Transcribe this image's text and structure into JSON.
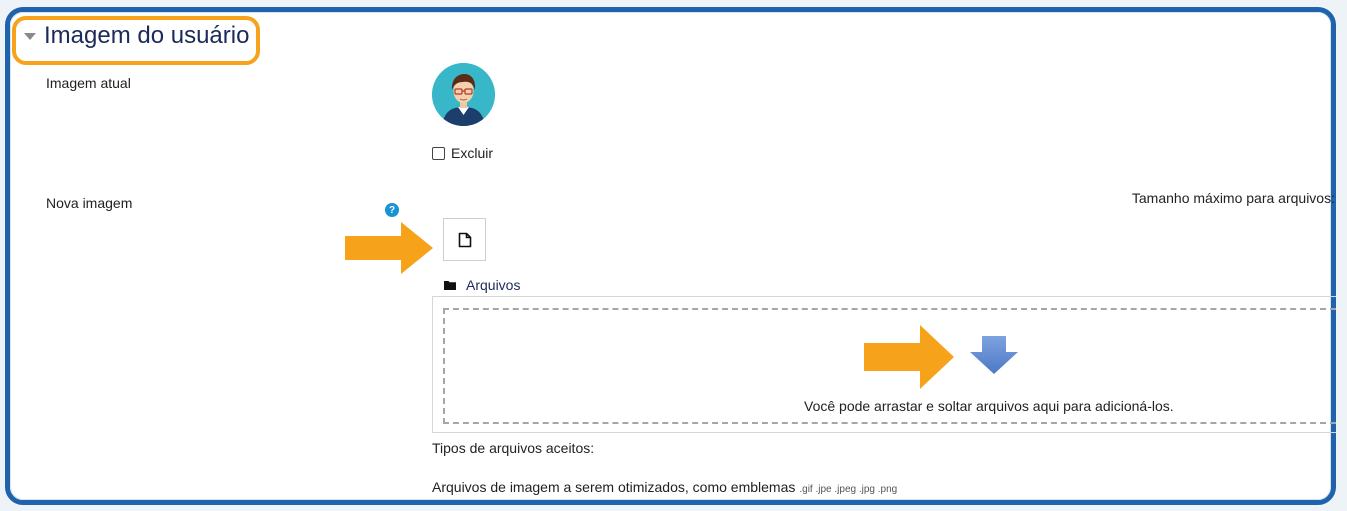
{
  "section": {
    "title": "Imagem do usuário"
  },
  "current_image": {
    "label": "Imagem atual",
    "delete_checkbox_label": "Excluir",
    "delete_checked": false
  },
  "new_image": {
    "label": "Nova imagem",
    "help_icon": "question-circle-icon",
    "max_size_text": "Tamanho máximo para arquivos:",
    "add_file_icon": "file-icon",
    "files_folder_label": "Arquivos",
    "drop_text": "Você pode arrastar e soltar arquivos aqui para adicioná-los.",
    "accepted_types_label": "Tipos de arquivos aceitos:",
    "accepted_types_desc": "Arquivos de imagem a serem otimizados, como emblemas",
    "accepted_extensions": ".gif .jpe .jpeg .jpg .png"
  },
  "colors": {
    "frame": "#1f63ad",
    "highlight": "#f7a21b",
    "annotation_arrow": "#f7a21b",
    "drop_arrow": "#5b86cf",
    "title": "#1b2a5a",
    "help": "#1794d2"
  }
}
